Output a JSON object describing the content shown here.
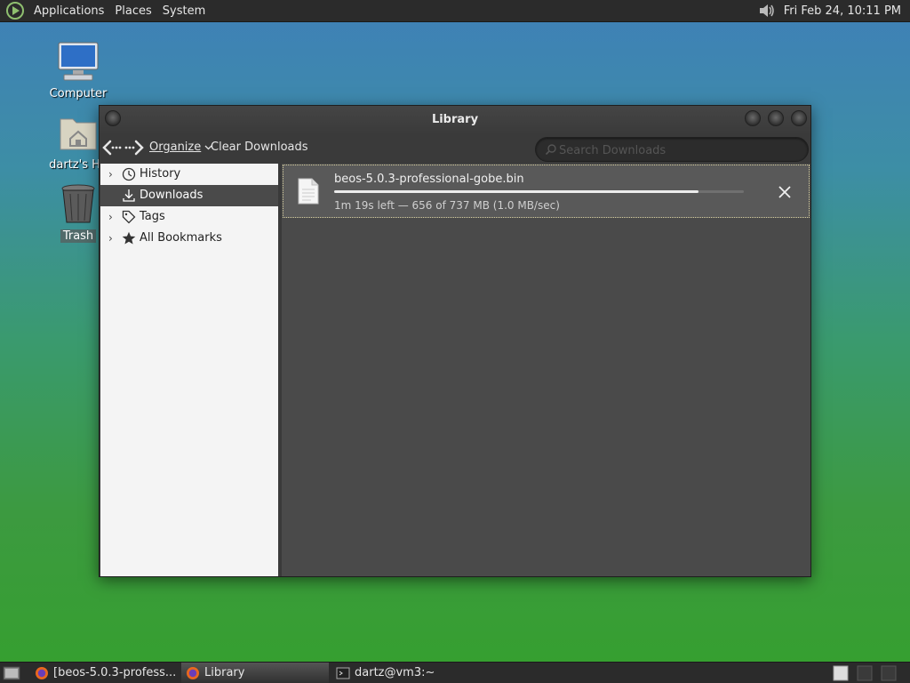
{
  "top_panel": {
    "menus": [
      "Applications",
      "Places",
      "System"
    ],
    "clock": "Fri Feb 24, 10:11 PM",
    "icons": [
      "distro-logo-icon",
      "volume-icon"
    ]
  },
  "desktop": {
    "icons": [
      {
        "label": "Computer",
        "icon": "computer-icon"
      },
      {
        "label": "dartz's Ho",
        "icon": "home-folder-icon"
      },
      {
        "label": "Trash",
        "icon": "trash-icon"
      }
    ]
  },
  "window": {
    "title": "Library",
    "toolbar": {
      "back_icon": "back-arrow-icon",
      "forward_icon": "forward-arrow-icon",
      "organize_label": "Organize",
      "clear_label": "Clear Downloads",
      "search_placeholder": "Search Downloads"
    },
    "sidebar": {
      "items": [
        {
          "label": "History",
          "icon": "clock-icon",
          "expandable": true,
          "selected": false
        },
        {
          "label": "Downloads",
          "icon": "download-icon",
          "expandable": false,
          "selected": true
        },
        {
          "label": "Tags",
          "icon": "tag-icon",
          "expandable": true,
          "selected": false
        },
        {
          "label": "All Bookmarks",
          "icon": "star-icon",
          "expandable": true,
          "selected": false
        }
      ]
    },
    "downloads": [
      {
        "filename": "beos-5.0.3-professional-gobe.bin",
        "status": "1m 19s left — 656 of 737 MB (1.0 MB/sec)",
        "progress": 0.89
      }
    ]
  },
  "taskbar": {
    "tasks": [
      {
        "label": "[beos-5.0.3-profess...",
        "icon": "firefox-icon",
        "active": false
      },
      {
        "label": "Library",
        "icon": "firefox-icon",
        "active": true
      },
      {
        "label": "dartz@vm3:~",
        "icon": "terminal-icon",
        "active": false
      }
    ]
  },
  "colors": {
    "panel": "#2b2b2b",
    "window_bg": "#3a3a3a",
    "sidebar_bg": "#f4f4f4",
    "content_bg": "#4a4a4a"
  }
}
